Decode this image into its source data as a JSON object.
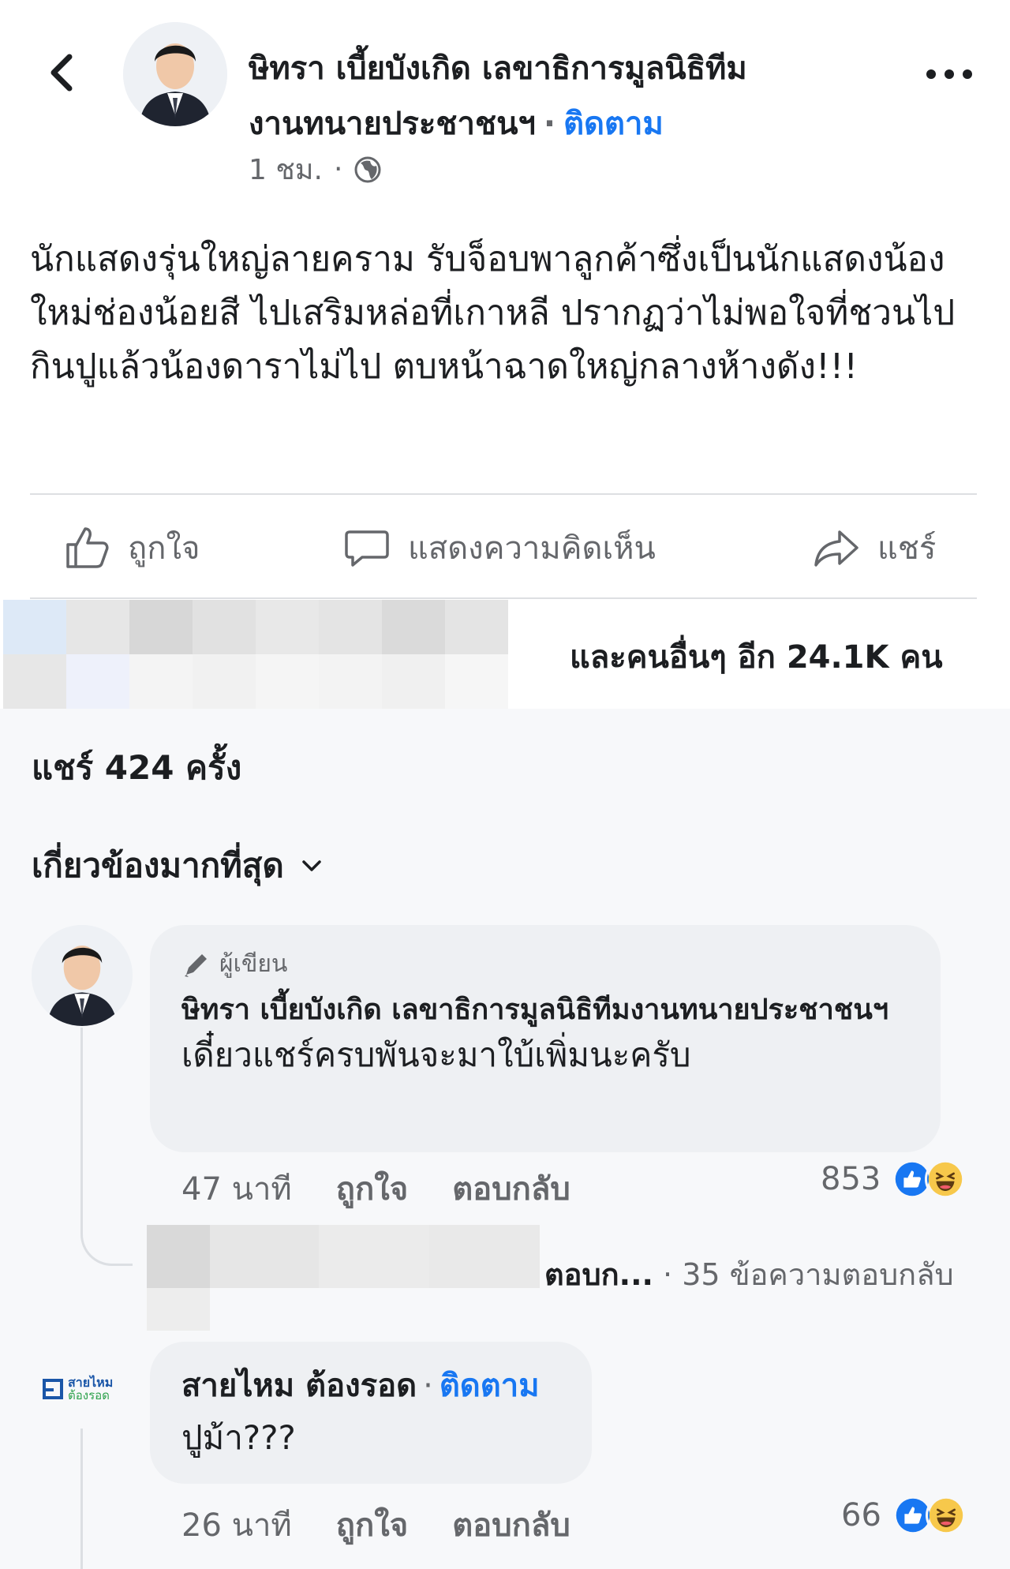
{
  "header": {
    "author_name_line1": "ษิทรา เบี้ยบังเกิด เลขาธิการมูลนิธิทีม",
    "author_name_line2": "งานทนายประชาชนฯ",
    "separator": "·",
    "follow_label": "ติดตาม",
    "post_time": "1 ชม.",
    "meta_separator": "·"
  },
  "post": {
    "text": "นักแสดงรุ่นใหญ่ลายคราม รับจ็อบพาลูกค้าซึ่งเป็นนักแสดงน้องใหม่ช่องน้อยสี ไปเสริมหล่อที่เกาหลี ปรากฏว่าไม่พอใจที่ชวนไปกินปูแล้วน้องดาราไม่ไป ตบหน้าฉาดใหญ่กลางห้างดัง!!!"
  },
  "actions": {
    "like_label": "ถูกใจ",
    "comment_label": "แสดงความคิดเห็น",
    "share_label": "แชร์"
  },
  "reactions": {
    "summary": "และคนอื่นๆ อีก 24.1K คน"
  },
  "shares": {
    "summary": "แชร์ 424 ครั้ง"
  },
  "sort": {
    "label": "เกี่ยวข้องมากที่สุด"
  },
  "comments": [
    {
      "badge": "ผู้เขียน",
      "name": "ษิทรา เบี้ยบังเกิด เลขาธิการมูลนิธิทีมงานทนายประชาชนฯ",
      "text": "เดี๋ยวแชร์ครบพันจะมาใบ้เพิ่มนะครับ",
      "time": "47 นาที",
      "like_label": "ถูกใจ",
      "reply_label": "ตอบกลับ",
      "reaction_count": "853",
      "replies_preview": "ตอบก...",
      "replies_count": "· 35 ข้อความตอบกลับ"
    },
    {
      "name": "สายไหม ต้องรอด",
      "separator": "·",
      "follow_label": "ติดตาม",
      "text": "ปูม้า???",
      "time": "26 นาที",
      "like_label": "ถูกใจ",
      "reply_label": "ตอบกลับ",
      "reaction_count": "66",
      "avatar_text_top": "สายไหม",
      "avatar_text_bottom": "ต้องรอด"
    }
  ],
  "colors": {
    "link_blue": "#1877f2",
    "text_primary": "#1c1e21",
    "text_secondary": "#65676b",
    "bubble_bg": "#eef0f3",
    "like_blue": "#1877f2",
    "haha_yellow": "#f7c84b"
  },
  "icons": {
    "back": "chevron-left-icon",
    "more": "more-dots-icon",
    "privacy": "globe-icon",
    "like": "thumbs-up-icon",
    "comment": "speech-bubble-icon",
    "share": "share-arrow-icon",
    "sort": "chevron-down-icon",
    "author_badge": "pencil-icon"
  }
}
